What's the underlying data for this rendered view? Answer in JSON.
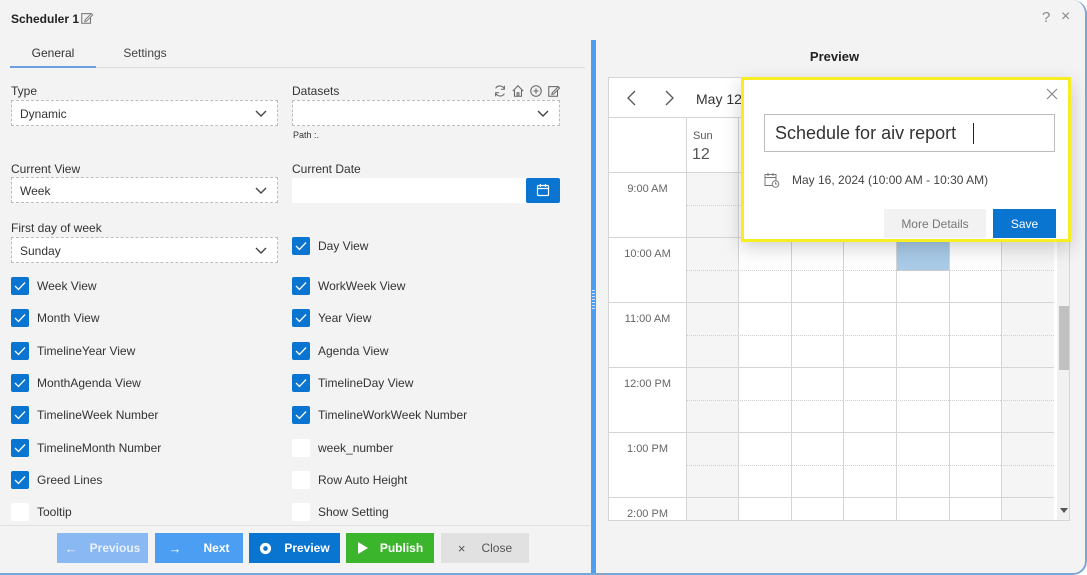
{
  "window": {
    "title": "Scheduler 1",
    "help_icon": "?",
    "close_icon": "×"
  },
  "tabs": [
    {
      "label": "General",
      "active": true
    },
    {
      "label": "Settings",
      "active": false
    }
  ],
  "form": {
    "type": {
      "label": "Type",
      "value": "Dynamic"
    },
    "datasets": {
      "label": "Datasets",
      "value": "",
      "path_label": "Path :.",
      "icons": [
        "refresh-icon",
        "home-icon",
        "add-circle-icon",
        "edit-icon"
      ]
    },
    "current_view": {
      "label": "Current View",
      "value": "Week"
    },
    "current_date": {
      "label": "Current Date",
      "value": ""
    },
    "first_day_of_week": {
      "label": "First day of week",
      "value": "Sunday"
    }
  },
  "checkboxes_left": [
    {
      "label": "Week View",
      "checked": true
    },
    {
      "label": "Month View",
      "checked": true
    },
    {
      "label": "TimelineYear View",
      "checked": true
    },
    {
      "label": "MonthAgenda View",
      "checked": true
    },
    {
      "label": "TimelineWeek Number",
      "checked": true
    },
    {
      "label": "TimelineMonth Number",
      "checked": true
    },
    {
      "label": "Greed Lines",
      "checked": true
    },
    {
      "label": "Tooltip",
      "checked": false
    }
  ],
  "checkboxes_right": [
    {
      "label": "Day View",
      "checked": true
    },
    {
      "label": "WorkWeek View",
      "checked": true
    },
    {
      "label": "Year View",
      "checked": true
    },
    {
      "label": "Agenda View",
      "checked": true
    },
    {
      "label": "TimelineDay View",
      "checked": true
    },
    {
      "label": "TimelineWorkWeek Number",
      "checked": true
    },
    {
      "label": "week_number",
      "checked": false
    },
    {
      "label": "Row Auto Height",
      "checked": false
    },
    {
      "label": "Show Setting",
      "checked": false
    }
  ],
  "footer": {
    "previous": "Previous",
    "next": "Next",
    "preview": "Preview",
    "publish": "Publish",
    "close": "Close"
  },
  "preview": {
    "title": "Preview",
    "date_range": "May 12",
    "header_day": {
      "name": "Sun",
      "date": "12"
    },
    "times": [
      "9:00 AM",
      "10:00 AM",
      "11:00 AM",
      "12:00 PM",
      "1:00 PM",
      "2:00 PM"
    ],
    "selected_slot": {
      "day_index": 4,
      "time": "10:00 AM"
    }
  },
  "popup": {
    "subject": "Schedule for aiv report",
    "event_time": "May 16, 2024 (10:00 AM - 10:30 AM)",
    "more_details": "More Details",
    "save": "Save",
    "highlight_color": "#f6ee22"
  },
  "colors": {
    "primary": "#0a74d1",
    "publish": "#3bb52b",
    "accent_border": "#4c9ef2"
  }
}
